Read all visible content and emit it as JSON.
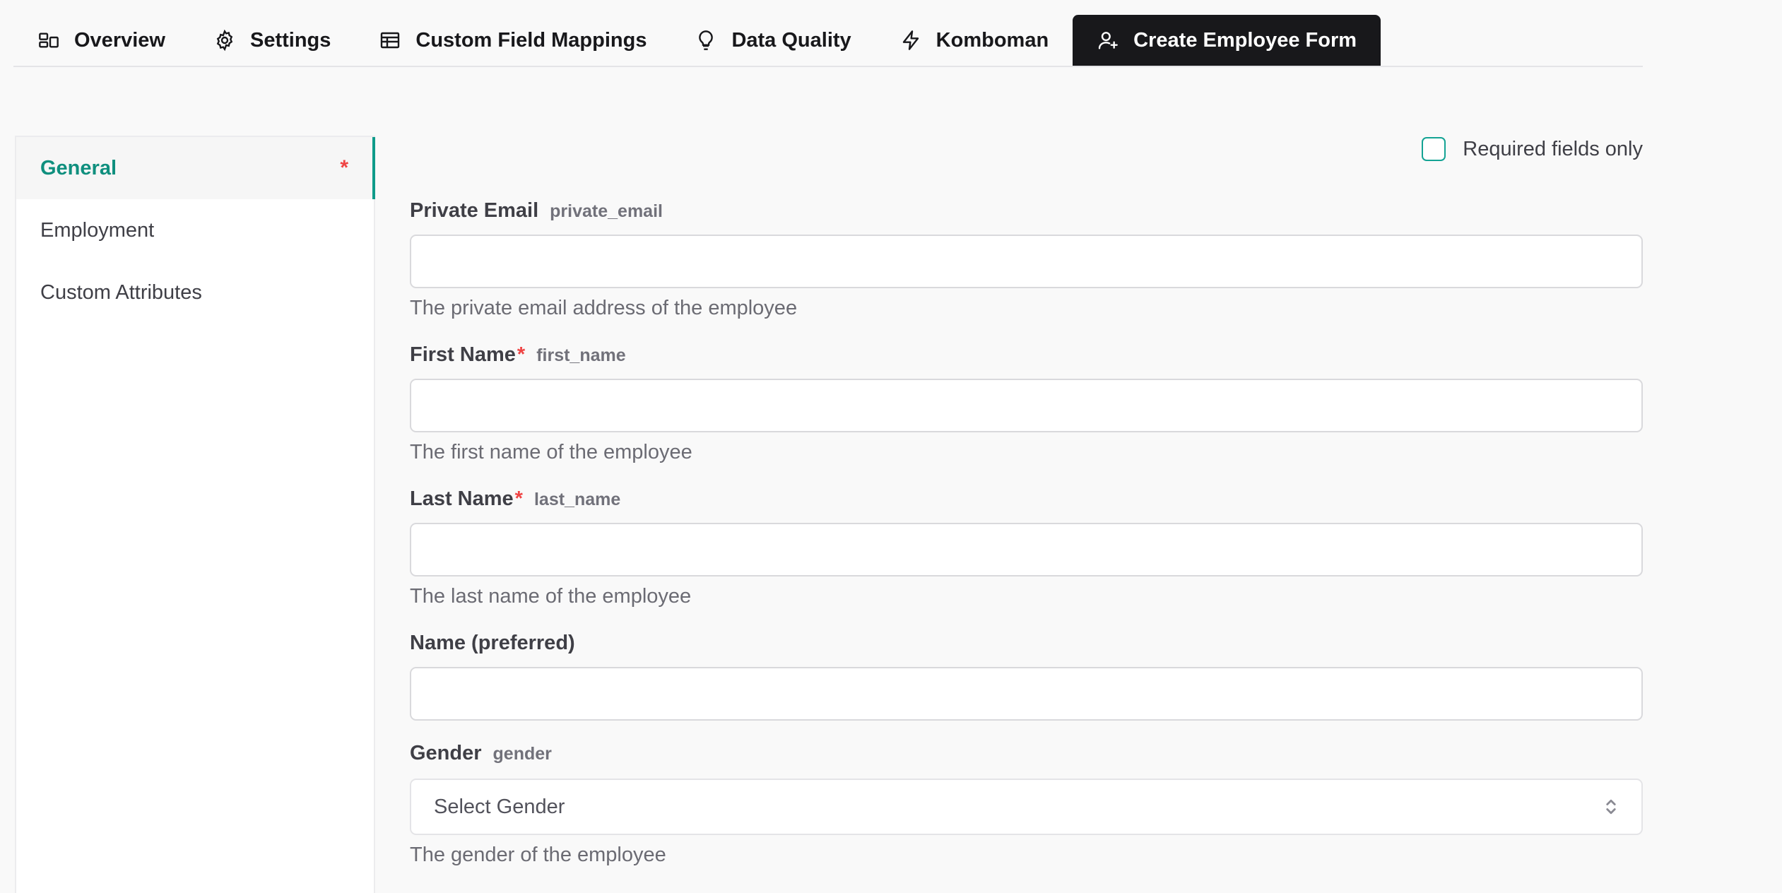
{
  "tabs": [
    {
      "label": "Overview",
      "icon": "overview-icon"
    },
    {
      "label": "Settings",
      "icon": "gear-icon"
    },
    {
      "label": "Custom Field Mappings",
      "icon": "table-icon"
    },
    {
      "label": "Data Quality",
      "icon": "lightbulb-icon"
    },
    {
      "label": "Komboman",
      "icon": "lightning-icon"
    },
    {
      "label": "Create Employee Form",
      "icon": "user-plus-icon",
      "active": true
    }
  ],
  "sidebar": {
    "items": [
      {
        "label": "General",
        "active": true,
        "required_mark": "*"
      },
      {
        "label": "Employment"
      },
      {
        "label": "Custom Attributes"
      }
    ]
  },
  "required_only": {
    "label": "Required fields only",
    "checked": false
  },
  "fields": {
    "private_email": {
      "label": "Private Email",
      "key": "private_email",
      "value": "",
      "help": "The private email address of the employee"
    },
    "first_name": {
      "label": "First Name",
      "required": "*",
      "key": "first_name",
      "value": "",
      "help": "The first name of the employee"
    },
    "last_name": {
      "label": "Last Name",
      "required": "*",
      "key": "last_name",
      "value": "",
      "help": "The last name of the employee"
    },
    "preferred_name": {
      "label": "Name (preferred)",
      "value": ""
    },
    "gender": {
      "label": "Gender",
      "key": "gender",
      "placeholder": "Select Gender",
      "help": "The gender of the employee"
    }
  },
  "colors": {
    "accent": "#0f9b8a",
    "required": "#ef4444",
    "active_tab_bg": "#18181b"
  }
}
